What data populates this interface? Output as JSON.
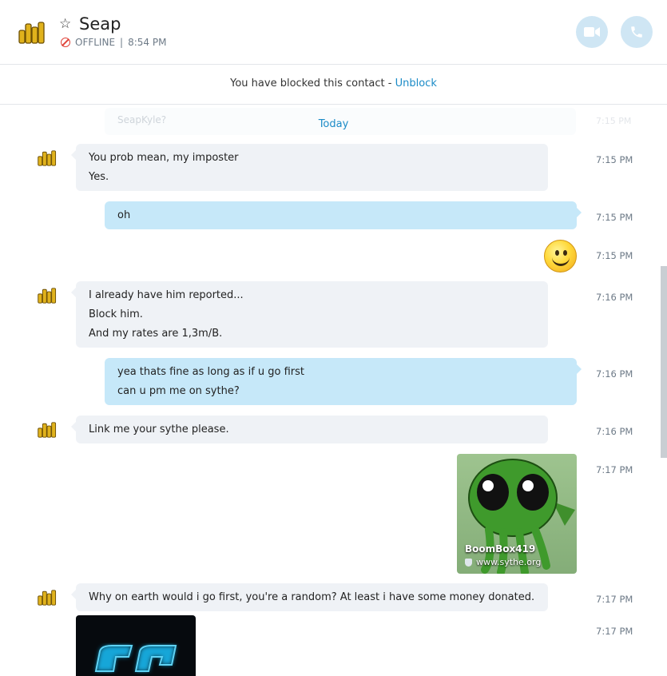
{
  "header": {
    "contact_name": "Seap",
    "status": "OFFLINE",
    "separator": "|",
    "last_seen": "8:54 PM"
  },
  "blocked_bar": {
    "text": "You have blocked this contact - ",
    "link": "Unblock"
  },
  "chat": {
    "faded_message": "SeapKyle?",
    "faded_time": "7:15 PM",
    "date_divider": "Today",
    "messages": [
      {
        "lines": [
          "You prob mean, my imposter",
          "Yes."
        ],
        "time": "7:15 PM"
      },
      {
        "lines": [
          "oh"
        ],
        "time": "7:15 PM"
      },
      {
        "emoji": "smiley",
        "time": "7:15 PM"
      },
      {
        "lines": [
          "I already have him reported...",
          "Block him.",
          "And my rates are 1,3m/B."
        ],
        "time": "7:16 PM"
      },
      {
        "lines": [
          "yea thats fine as long as if u go first",
          "can u pm me on sythe?"
        ],
        "time": "7:16 PM"
      },
      {
        "lines": [
          "Link me your sythe please."
        ],
        "time": "7:16 PM"
      },
      {
        "card_title": "BoomBox419",
        "card_url": "www.sythe.org",
        "time": "7:17 PM"
      },
      {
        "lines": [
          "Why on earth would i go first, you're a random? At least i have some money donated."
        ],
        "time": "7:17 PM"
      },
      {
        "image": "logo-image",
        "time": "7:17 PM"
      }
    ]
  },
  "colors": {
    "incoming_bubble": "#eff2f6",
    "outgoing_bubble": "#c6e8f9",
    "accent": "#1b8bc7",
    "offline": "#e0443a"
  }
}
